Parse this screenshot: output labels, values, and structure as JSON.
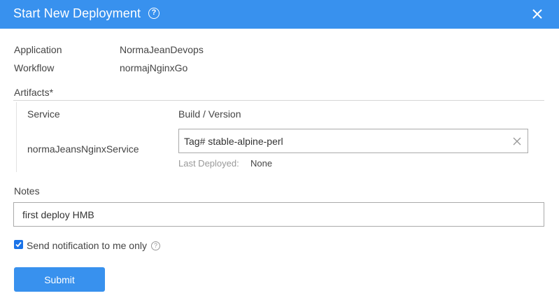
{
  "dialog": {
    "title": "Start New Deployment",
    "help_glyph": "?"
  },
  "summary": {
    "application_label": "Application",
    "application_value": "NormaJeanDevops",
    "workflow_label": "Workflow",
    "workflow_value": "normajNginxGo"
  },
  "artifacts": {
    "section_label": "Artifacts*",
    "service_header": "Service",
    "build_header": "Build / Version",
    "rows": [
      {
        "service": "normaJeansNginxService",
        "build_value": "Tag# stable-alpine-perl",
        "last_deployed_label": "Last Deployed:",
        "last_deployed_value": "None"
      }
    ]
  },
  "notes": {
    "label": "Notes",
    "value": "first deploy HMB"
  },
  "notify": {
    "label": "Send notification to me only",
    "checked": true,
    "help_glyph": "?"
  },
  "submit_label": "Submit",
  "colors": {
    "header_bg": "#3891ee",
    "button_bg": "#3891ee",
    "checkbox": "#1a73e8"
  }
}
